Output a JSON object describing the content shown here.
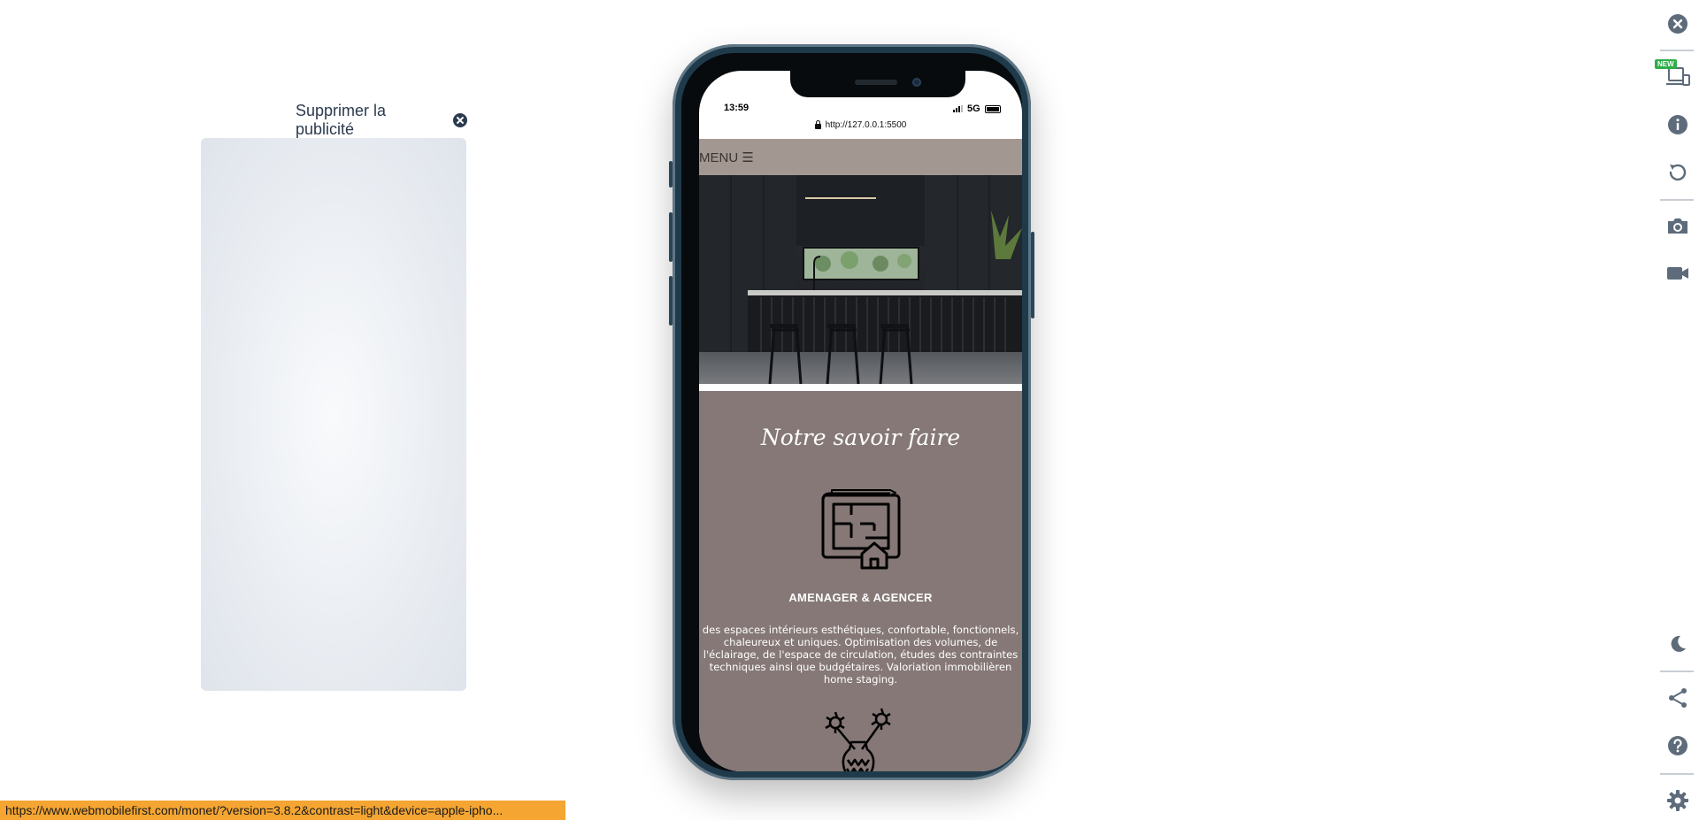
{
  "ad": {
    "remove_label": "Supprimer la publicité"
  },
  "phone": {
    "status_time": "13:59",
    "network": "5G",
    "url": "http://127.0.0.1:5500"
  },
  "site": {
    "menu_label": "MENU ☰",
    "section_title": "Notre savoir faire",
    "service_title": "AMENAGER & AGENCER",
    "service_description": "des espaces intérieurs esthétiques, confortable, fonctionnels, chaleureux et uniques. Optimisation des volumes, de l'éclairage, de l'espace de circulation, études des contraintes techniques ainsi que budgétaires. Valoriation immobilièren home staging."
  },
  "toolbar": {
    "new_badge": "NEW",
    "icons": [
      "close-icon",
      "devices-icon",
      "info-icon",
      "rotate-icon",
      "camera-icon",
      "video-icon",
      "moon-icon",
      "share-icon",
      "help-icon",
      "settings-icon"
    ]
  },
  "status_bar": {
    "url": "https://www.webmobilefirst.com/monet/?version=3.8.2&contrast=light&device=apple-ipho..."
  },
  "colors": {
    "menu_bg": "#a39891",
    "section_bg": "#857876",
    "phone_frame": "#1f3a4a",
    "status_url_bg": "#f4a532",
    "toolbar_icon": "#5d6b7a"
  }
}
